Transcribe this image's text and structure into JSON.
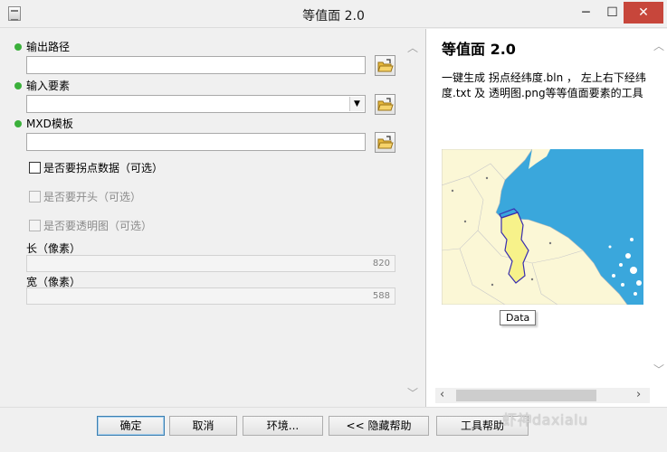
{
  "window": {
    "title": "等值面 2.0",
    "minimize_glyph": "─",
    "maximize_glyph": "☐",
    "close_glyph": "✕"
  },
  "form": {
    "output_path": {
      "label": "输出路径",
      "value": ""
    },
    "input_features": {
      "label": "输入要素",
      "value": ""
    },
    "mxd_template": {
      "label": "MXD模板",
      "value": ""
    },
    "checkbox_points": {
      "label": "是否要拐点数据（可选）",
      "checked": false,
      "enabled": true
    },
    "checkbox_head": {
      "label": "是否要开头（可选）",
      "checked": false,
      "enabled": false
    },
    "checkbox_transparent": {
      "label": "是否要透明图（可选）",
      "checked": false,
      "enabled": false
    },
    "length": {
      "label": "长（像素）",
      "value": "820"
    },
    "width": {
      "label": "宽（像素）",
      "value": "588"
    }
  },
  "help": {
    "title": "等值面  2.0",
    "description": "一键生成  拐点经纬度.bln ，  左上右下经纬度.txt 及  透明图.png等等值面要素的工具",
    "tooltip": "Data"
  },
  "buttons": {
    "ok": "确定",
    "cancel": "取消",
    "environments": "环境...",
    "hide_help": "<< 隐藏帮助",
    "tool_help": "工具帮助"
  },
  "watermark": "虾神daxialu",
  "colors": {
    "required_dot": "#3bb03b",
    "sea": "#3aa7dc",
    "land": "#fbf7d6",
    "highlight_region": "#f7f28a",
    "close_button": "#c7463b"
  }
}
